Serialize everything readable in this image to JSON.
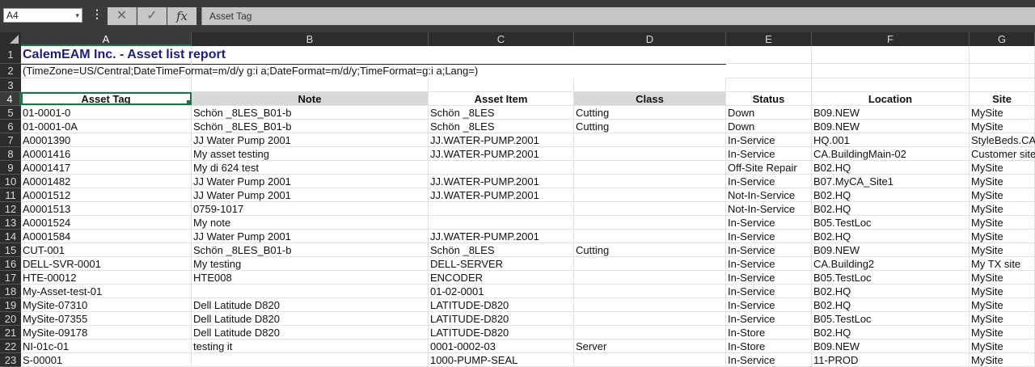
{
  "formula_bar": {
    "name_box": "A4",
    "name_box_dropdown": "▾",
    "more_icon": "⋮",
    "cancel_icon": "✕",
    "enter_icon": "✓",
    "fx_label": "fx",
    "content": "Asset Tag"
  },
  "columns": [
    "A",
    "B",
    "C",
    "D",
    "E",
    "F",
    "G"
  ],
  "rows": {
    "numbers": [
      "1",
      "2",
      "3",
      "4",
      "5",
      "6",
      "7",
      "8",
      "9",
      "10",
      "11",
      "12",
      "13",
      "14",
      "15",
      "16",
      "17",
      "18",
      "19",
      "20",
      "21",
      "22",
      "23"
    ]
  },
  "sheet": {
    "title": "CalemEAM Inc. - Asset list report",
    "params": "(TimeZone=US/Central;DateTimeFormat=m/d/y g:i a;DateFormat=m/d/y;TimeFormat=g:i a;Lang=)",
    "headers": [
      "Asset Tag",
      "Note",
      "Asset Item",
      "Class",
      "Status",
      "Location",
      "Site"
    ],
    "data": [
      [
        "01-0001-0",
        "Schön _8LES_B01-b",
        "Schön _8LES",
        "Cutting",
        "Down",
        "B09.NEW",
        "MySite"
      ],
      [
        "01-0001-0A",
        "Schön _8LES_B01-b",
        "Schön _8LES",
        "Cutting",
        "Down",
        "B09.NEW",
        "MySite"
      ],
      [
        "A0001390",
        "JJ Water Pump 2001",
        "JJ.WATER-PUMP.2001",
        "",
        "In-Service",
        "HQ.001",
        "StyleBeds.CA"
      ],
      [
        "A0001416",
        "My asset testing",
        "JJ.WATER-PUMP.2001",
        "",
        "In-Service",
        "CA.BuildingMain-02",
        "Customer site"
      ],
      [
        "A0001417",
        "My di 624 test",
        "",
        "",
        "Off-Site Repair",
        "B02.HQ",
        "MySite"
      ],
      [
        "A0001482",
        "JJ Water Pump 2001",
        "JJ.WATER-PUMP.2001",
        "",
        "In-Service",
        "B07.MyCA_Site1",
        "MySite"
      ],
      [
        "A0001512",
        "JJ Water Pump 2001",
        "JJ.WATER-PUMP.2001",
        "",
        "Not-In-Service",
        "B02.HQ",
        "MySite"
      ],
      [
        "A0001513",
        "0759-1017",
        "",
        "",
        "Not-In-Service",
        "B02.HQ",
        "MySite"
      ],
      [
        "A0001524",
        "My note",
        "",
        "",
        "In-Service",
        "B05.TestLoc",
        "MySite"
      ],
      [
        "A0001584",
        "JJ Water Pump 2001",
        "JJ.WATER-PUMP.2001",
        "",
        "In-Service",
        "B02.HQ",
        "MySite"
      ],
      [
        "CUT-001",
        "Schön _8LES_B01-b",
        "Schön _8LES",
        "Cutting",
        "In-Service",
        "B09.NEW",
        "MySite"
      ],
      [
        "DELL-SVR-0001",
        "My testing",
        "DELL-SERVER",
        "",
        "In-Service",
        "CA.Building2",
        "My TX site"
      ],
      [
        "HTE-00012",
        "HTE008",
        "ENCODER",
        "",
        "In-Service",
        "B05.TestLoc",
        "MySite"
      ],
      [
        "My-Asset-test-01",
        "",
        "01-02-0001",
        "",
        "In-Service",
        "B02.HQ",
        "MySite"
      ],
      [
        "MySite-07310",
        "Dell Latitude D820",
        "LATITUDE-D820",
        "",
        "In-Service",
        "B02.HQ",
        "MySite"
      ],
      [
        "MySite-07355",
        "Dell Latitude D820",
        "LATITUDE-D820",
        "",
        "In-Service",
        "B05.TestLoc",
        "MySite"
      ],
      [
        "MySite-09178",
        "Dell Latitude D820",
        "LATITUDE-D820",
        "",
        "In-Store",
        "B02.HQ",
        "MySite"
      ],
      [
        "NI-01c-01",
        "testing it",
        "0001-0002-03",
        "Server",
        "In-Store",
        "B09.NEW",
        "MySite"
      ],
      [
        "S-00001",
        "",
        "1000-PUMP-SEAL",
        "",
        "In-Service",
        "11-PROD",
        "MySite"
      ]
    ]
  },
  "colors": {
    "selection": "#217346",
    "title_text": "#1f1f7a",
    "chrome_dark": "#2d2d2d"
  }
}
